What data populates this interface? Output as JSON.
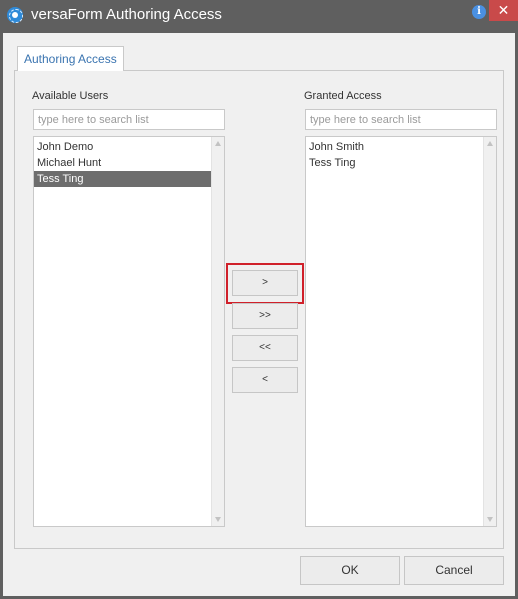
{
  "window": {
    "title": "versaForm Authoring Access",
    "info_glyph": "i",
    "close_glyph": "✕"
  },
  "tab": {
    "label": "Authoring Access"
  },
  "available": {
    "label": "Available Users",
    "search_placeholder": "type here to search list",
    "items": [
      {
        "label": "John Demo",
        "selected": false
      },
      {
        "label": "Michael Hunt",
        "selected": false
      },
      {
        "label": "Tess Ting",
        "selected": true
      }
    ]
  },
  "granted": {
    "label": "Granted Access",
    "search_placeholder": "type here to search list",
    "items": [
      {
        "label": "John Smith",
        "selected": false
      },
      {
        "label": "Tess Ting",
        "selected": false
      }
    ]
  },
  "move_buttons": {
    "add": ">",
    "add_all": ">>",
    "remove_all": "<<",
    "remove": "<"
  },
  "footer": {
    "ok_label": "OK",
    "cancel_label": "Cancel"
  },
  "colors": {
    "titlebar": "#5f5f5f",
    "close_button": "#c94a4a",
    "selection": "#6d6d6d",
    "highlight_box": "#d0202a",
    "tab_text": "#3a74b0"
  }
}
